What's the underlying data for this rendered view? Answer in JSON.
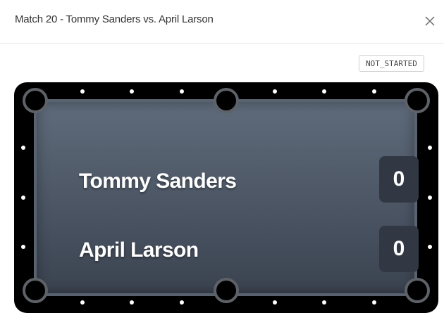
{
  "dialog": {
    "title": "Match 20 - Tommy Sanders vs. April Larson",
    "close_icon": "close-icon"
  },
  "match": {
    "status": "NOT_STARTED",
    "players": [
      {
        "name": "Tommy Sanders",
        "score": "0"
      },
      {
        "name": "April Larson",
        "score": "0"
      }
    ]
  },
  "colors": {
    "rail": "#000000",
    "felt": "#4d5766",
    "score_box": "#323843"
  }
}
